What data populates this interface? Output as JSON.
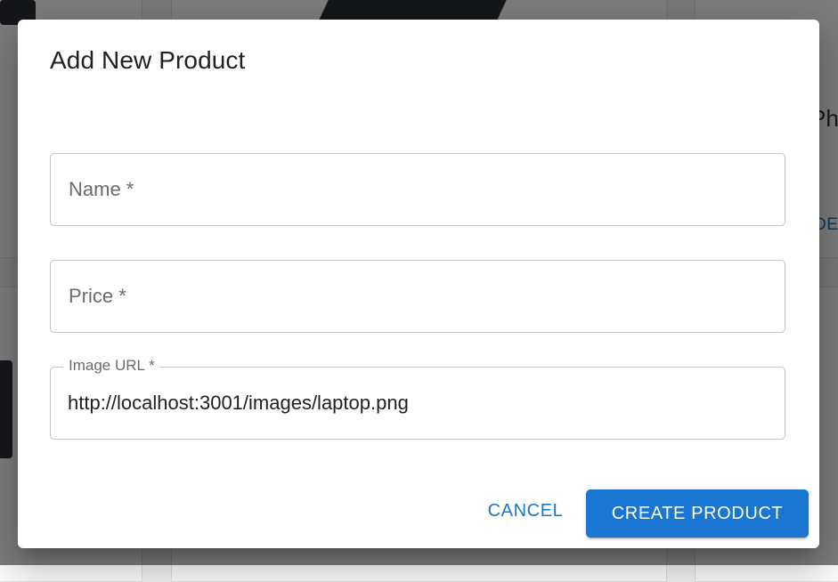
{
  "background": {
    "partial_card_title": "Ph",
    "partial_card_link": "DE"
  },
  "dialog": {
    "title": "Add New Product",
    "fields": [
      {
        "label": "Name *",
        "value": ""
      },
      {
        "label": "Price *",
        "value": ""
      },
      {
        "label": "Image URL *",
        "value": "http://localhost:3001/images/laptop.png"
      }
    ],
    "cancel_label": "CANCEL",
    "submit_label": "CREATE PRODUCT"
  },
  "colors": {
    "primary": "#1976d2",
    "overlay": "rgba(0,0,0,0.5)"
  }
}
